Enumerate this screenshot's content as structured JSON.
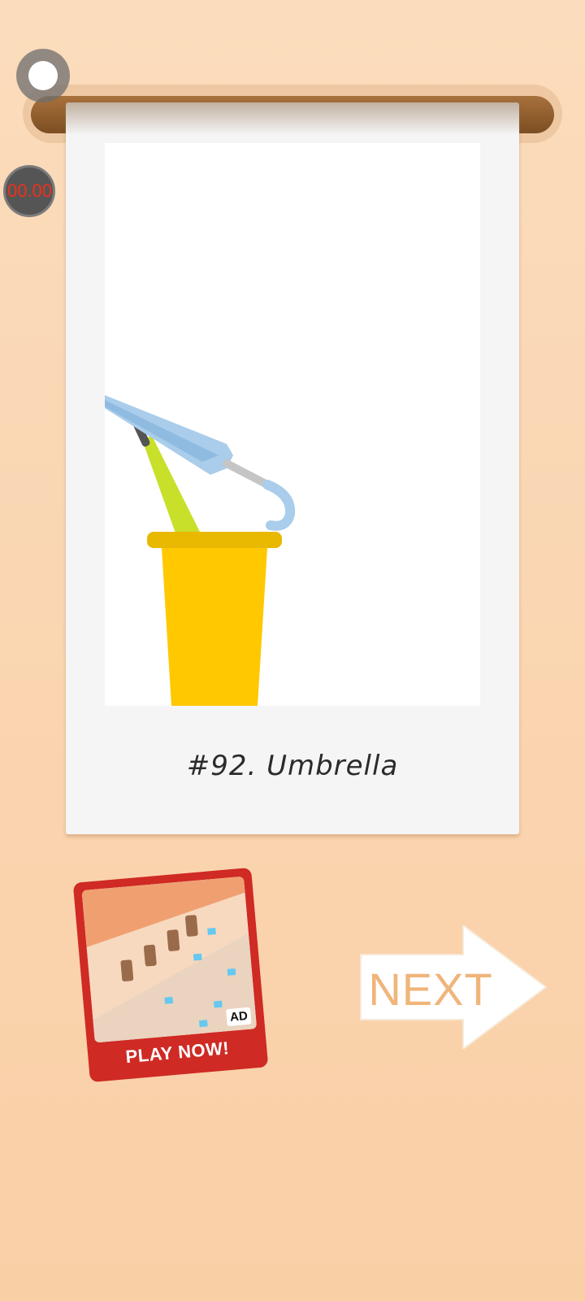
{
  "timer": {
    "label": "00.00"
  },
  "drawing": {
    "caption": "#92. Umbrella"
  },
  "ad": {
    "badge": "AD",
    "cta": "PLAY NOW!"
  },
  "navigation": {
    "next_label": "NEXT"
  },
  "colors": {
    "background": "#fbdcbc",
    "rod": "#8a5a2b",
    "timer_text": "#e8311e",
    "ad_frame": "#cf2a24",
    "next_text": "#f0b57a",
    "bin": "#ffc800",
    "umbrella": "#a9cdea"
  },
  "icons": [
    "pin-icon",
    "next-arrow-icon"
  ]
}
